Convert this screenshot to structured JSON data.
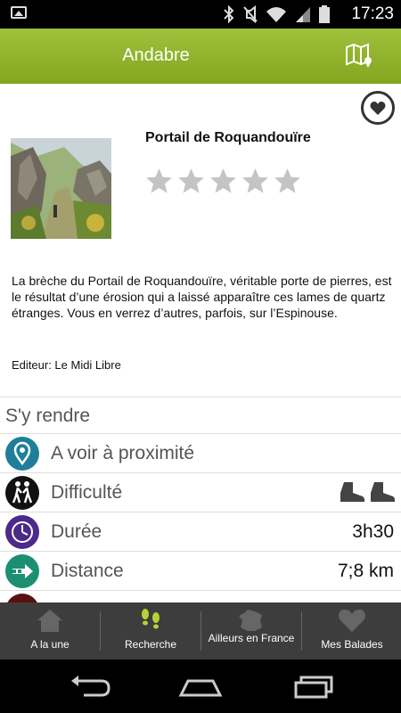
{
  "status_bar": {
    "time": "17:23"
  },
  "app_bar": {
    "title": "Andabre"
  },
  "place": {
    "title": "Portail de Roquandouïre",
    "rating": 0,
    "rating_max": 5,
    "description": "La brèche du Portail de Roquandouïre, véritable porte de pierres, est le résultat d’une érosion qui a laissé apparaître ces lames de quartz étranges. Vous en verrez d’autres, parfois, sur l’Espinouse.",
    "editor": "Editeur: Le Midi Libre"
  },
  "section": {
    "title": "S'y rendre"
  },
  "rows": [
    {
      "label": "A voir à proximité",
      "value": "",
      "icon": "location-pin-icon",
      "color": "#1f7f9a"
    },
    {
      "label": "Difficulté",
      "value": "",
      "icon": "hikers-icon",
      "color": "#111111"
    },
    {
      "label": "Durée",
      "value": "3h30",
      "icon": "clock-icon",
      "color": "#4b2a8a"
    },
    {
      "label": "Distance",
      "value": "7;8 km",
      "icon": "arrow-right-icon",
      "color": "#1c8f73"
    }
  ],
  "tabs": [
    {
      "label": "A la une",
      "icon": "home-icon"
    },
    {
      "label": "Recherche",
      "icon": "footprints-icon"
    },
    {
      "label": "Ailleurs en France",
      "icon": "france-map-icon"
    },
    {
      "label": "Mes Balades",
      "icon": "heart-icon"
    }
  ],
  "colors": {
    "accent": "#94b52c",
    "tab_bar": "#3d3d3d",
    "footprints": "#b6d334"
  }
}
